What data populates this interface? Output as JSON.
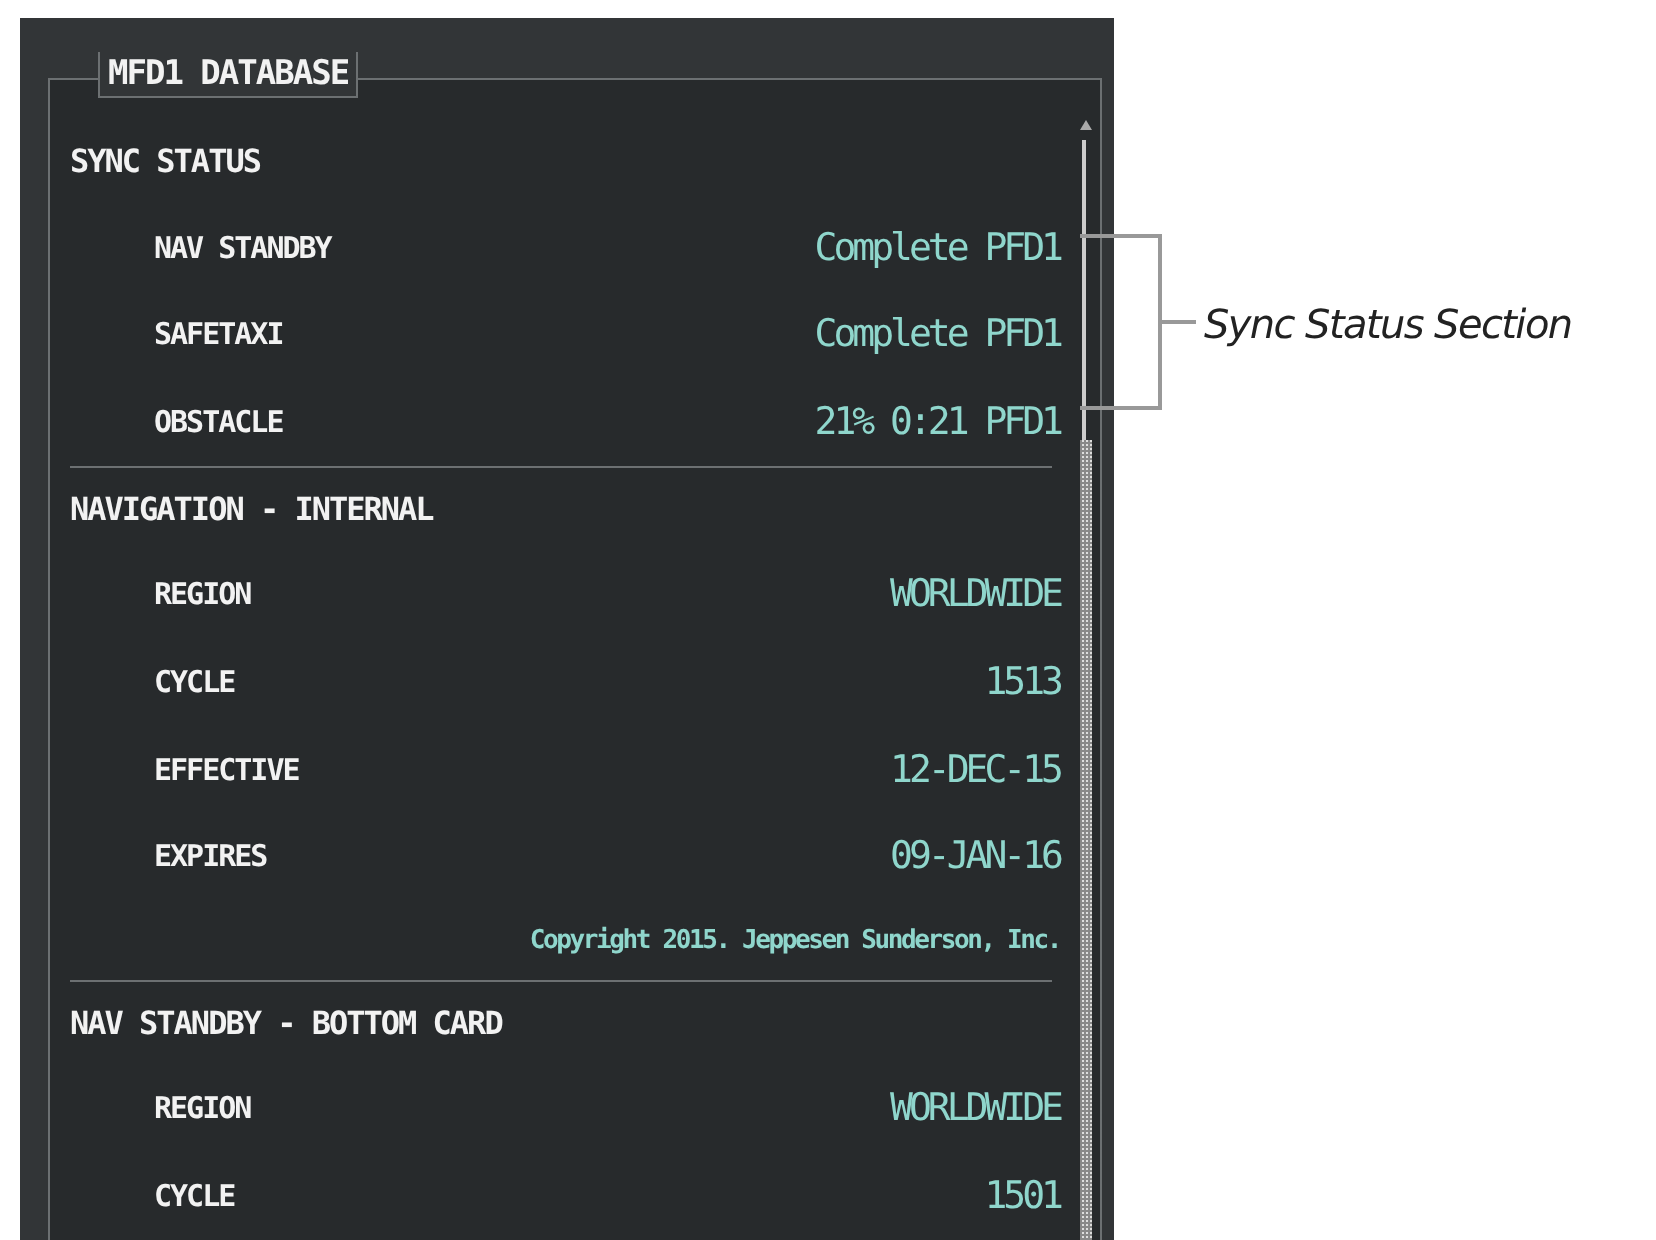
{
  "panel": {
    "title": "MFD1 DATABASE"
  },
  "sections": [
    {
      "heading": "SYNC STATUS",
      "rows": [
        {
          "label": "NAV STANDBY",
          "value": "Complete PFD1"
        },
        {
          "label": "SAFETAXI",
          "value": "Complete PFD1"
        },
        {
          "label": "OBSTACLE",
          "value": "21% 0:21 PFD1"
        }
      ]
    },
    {
      "heading": "NAVIGATION - INTERNAL",
      "rows": [
        {
          "label": "REGION",
          "value": "WORLDWIDE"
        },
        {
          "label": "CYCLE",
          "value": "1513"
        },
        {
          "label": "EFFECTIVE",
          "value": "12-DEC-15"
        },
        {
          "label": "EXPIRES",
          "value": "09-JAN-16"
        }
      ],
      "note": "Copyright 2015. Jeppesen Sunderson, Inc."
    },
    {
      "heading": "NAV STANDBY - BOTTOM CARD",
      "rows": [
        {
          "label": "REGION",
          "value": "WORLDWIDE"
        },
        {
          "label": "CYCLE",
          "value": "1501"
        }
      ]
    }
  ],
  "callout": {
    "label": "Sync Status Section"
  }
}
